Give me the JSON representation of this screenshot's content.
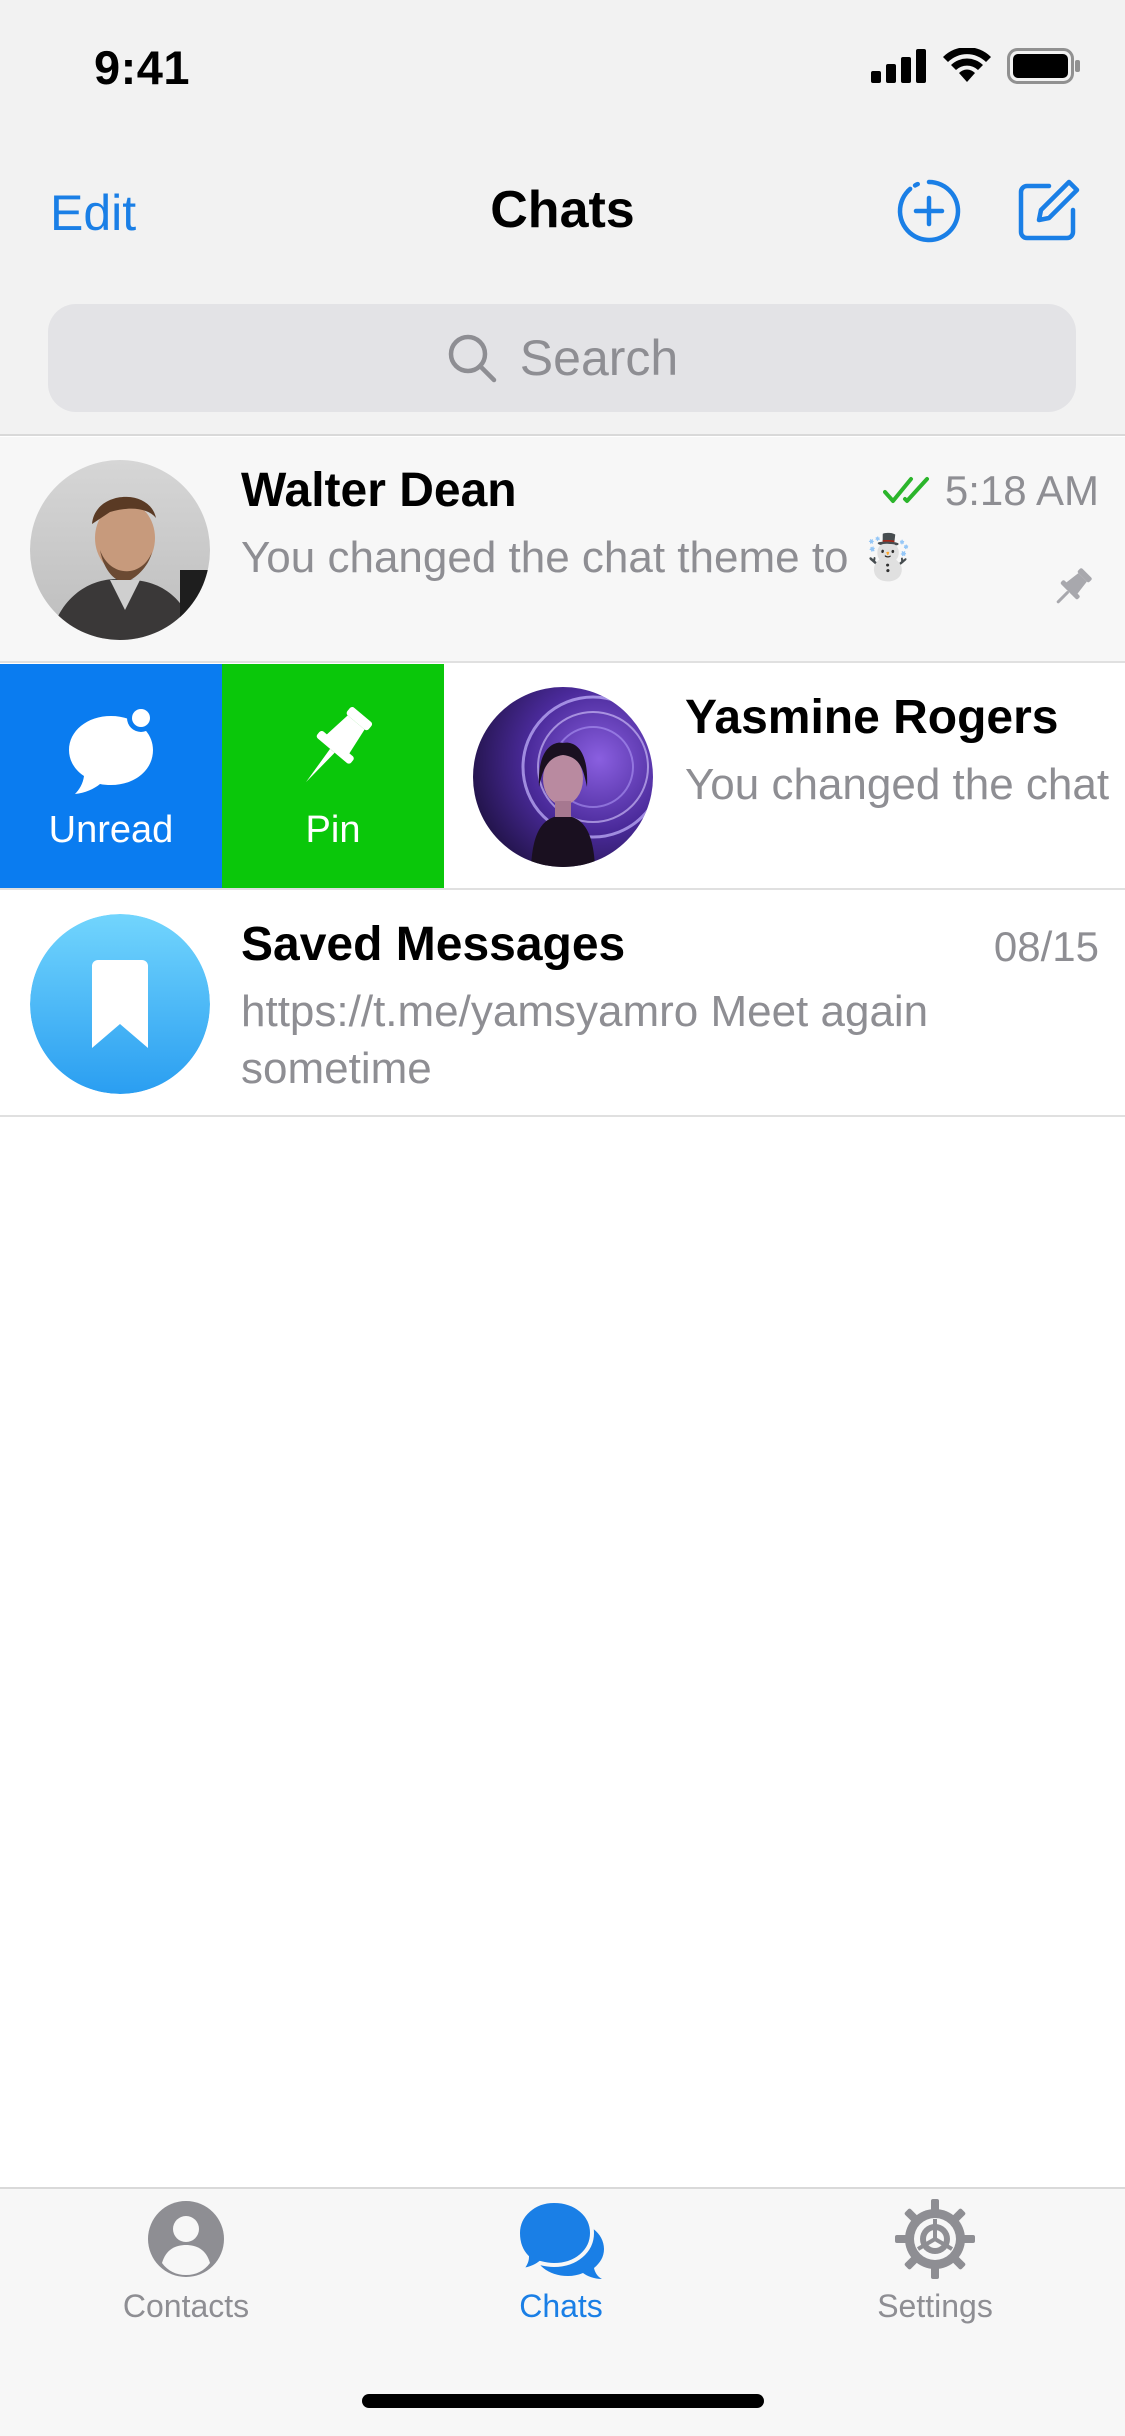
{
  "status_bar": {
    "time": "9:41"
  },
  "nav": {
    "edit_label": "Edit",
    "title": "Chats"
  },
  "search": {
    "placeholder": "Search"
  },
  "chats": [
    {
      "name": "Walter Dean",
      "time": "5:18 AM",
      "preview": "You changed the chat theme to ☃️",
      "read_status": "double-check",
      "pinned": true
    },
    {
      "name": "Yasmine Rogers",
      "preview": "You changed the chat"
    },
    {
      "name": "Saved Messages",
      "time": "08/15",
      "preview": "https://t.me/yamsyamro Meet again sometime"
    }
  ],
  "swipe_actions": [
    {
      "label": "Unread",
      "color": "#0a7cf0",
      "icon": "unread-bubble-icon"
    },
    {
      "label": "Pin",
      "color": "#0ac70a",
      "icon": "pin-icon"
    }
  ],
  "tabs": [
    {
      "label": "Contacts",
      "icon": "person-icon",
      "active": false
    },
    {
      "label": "Chats",
      "icon": "chat-bubbles-icon",
      "active": true
    },
    {
      "label": "Settings",
      "icon": "gear-icon",
      "active": false
    }
  ],
  "colors": {
    "accent": "#1a7fe6",
    "check_green": "#2bb52b",
    "inactive": "#8e8e93"
  }
}
